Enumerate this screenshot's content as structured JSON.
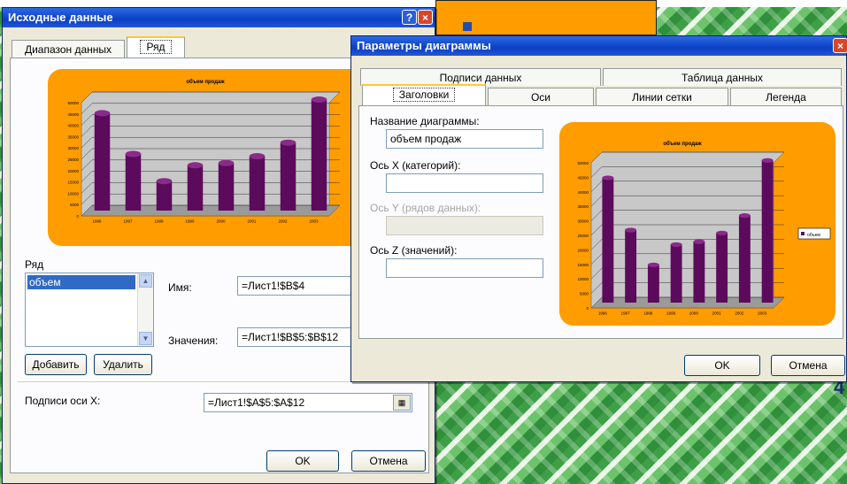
{
  "source_dialog": {
    "title": "Исходные данные",
    "tabs": [
      "Диапазон данных",
      "Ряд"
    ],
    "series_label": "Ряд",
    "series_list": [
      "объем"
    ],
    "add_button": "Добавить",
    "remove_button": "Удалить",
    "name_label": "Имя:",
    "name_value": "=Лист1!$B$4",
    "values_label": "Значения:",
    "values_value": "=Лист1!$B$5:$B$12",
    "x_labels_label": "Подписи оси X:",
    "x_labels_value": "=Лист1!$A$5:$A$12",
    "ok": "OK",
    "cancel": "Отмена"
  },
  "params_dialog": {
    "title": "Параметры диаграммы",
    "tabs_back": [
      "Подписи данных",
      "Таблица данных"
    ],
    "tabs_front": [
      "Заголовки",
      "Оси",
      "Линии сетки",
      "Легенда"
    ],
    "chart_title_label": "Название диаграммы:",
    "chart_title_value": "объем продаж",
    "axis_x_label": "Ось X (категорий):",
    "axis_y_label": "Ось Y (рядов данных):",
    "axis_z_label": "Ось Z (значений):",
    "ok": "OK",
    "cancel": "Отмена"
  },
  "slide_number": "4",
  "colors": {
    "bar": "#5c0a5c",
    "chart_bg": "#ff9c00",
    "plot_bg": "#c8c8c8",
    "accent": "#0a3fc4"
  },
  "chart_data": {
    "type": "bar",
    "title": "объем продаж",
    "categories": [
      "1996",
      "1997",
      "1998",
      "1999",
      "2000",
      "2001",
      "2002",
      "2003"
    ],
    "series": [
      {
        "name": "объем",
        "values": [
          43000,
          25000,
          13000,
          20000,
          21000,
          24000,
          30000,
          49000
        ]
      }
    ],
    "ylim": [
      0,
      50000
    ],
    "yticks": [
      0,
      5000,
      10000,
      15000,
      20000,
      25000,
      30000,
      35000,
      40000,
      45000,
      50000
    ],
    "grid": true,
    "legend": "right"
  }
}
